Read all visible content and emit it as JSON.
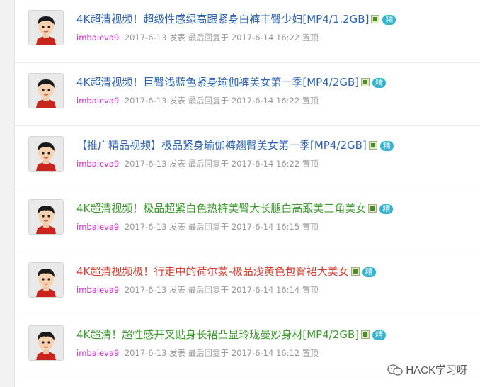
{
  "colors": {
    "blue": "#2d64b3",
    "green": "#3a9c2b",
    "red": "#d63b2b",
    "author": "#d02ad0",
    "meta": "#9a9a9a",
    "badge": "#2fb4d2"
  },
  "threads": [
    {
      "title": "4K超清视频！超级性感绿高跟紧身白裤丰臀少妇[MP4/1.2GB]",
      "color": "blue",
      "author": "imbaieva9",
      "post_date": "2017-6-13",
      "post_label": "发表",
      "reply_label": "最后回复于",
      "reply_time": "2017-6-14 16:22",
      "pin_label": "置顶",
      "badge": "精"
    },
    {
      "title": "4K超清视频！巨臀浅蓝色紧身瑜伽裤美女第一季[MP4/2GB]",
      "color": "blue",
      "author": "imbaieva9",
      "post_date": "2017-6-13",
      "post_label": "发表",
      "reply_label": "最后回复于",
      "reply_time": "2017-6-14 16:22",
      "pin_label": "置顶",
      "badge": "精"
    },
    {
      "title": "【推广精品视频】极品紧身瑜伽裤翘臀美女第一季[MP4/2GB]",
      "color": "blue",
      "author": "imbaieva9",
      "post_date": "2017-6-13",
      "post_label": "发表",
      "reply_label": "最后回复于",
      "reply_time": "2017-6-14 16:22",
      "pin_label": "置顶",
      "badge": "精"
    },
    {
      "title": "4K超清视频！极品超紧白色热裤美臀大长腿白高跟美三角美女",
      "color": "green",
      "author": "imbaieva9",
      "post_date": "2017-6-13",
      "post_label": "发表",
      "reply_label": "最后回复于",
      "reply_time": "2017-6-14 16:15",
      "pin_label": "置顶",
      "badge": "精"
    },
    {
      "title": "4K超清视频极！行走中的荷尔蒙-极品浅黄色包臀裙大美女",
      "color": "red",
      "author": "imbaieva9",
      "post_date": "2017-6-13",
      "post_label": "发表",
      "reply_label": "最后回复于",
      "reply_time": "2017-6-14 16:14",
      "pin_label": "置顶",
      "badge": "精"
    },
    {
      "title": "4K超清！超性感开叉贴身长裙凸显玲珑曼妙身材[MP4/2GB]",
      "color": "green",
      "author": "imbaieva9",
      "post_date": "2017-6-13",
      "post_label": "发表",
      "reply_label": "最后回复于",
      "reply_time": "2017-6-14 16:12",
      "pin_label": "置顶",
      "badge": "精"
    }
  ],
  "watermark": {
    "text": "HACK学习呀",
    "icon": "wechat-icon"
  }
}
